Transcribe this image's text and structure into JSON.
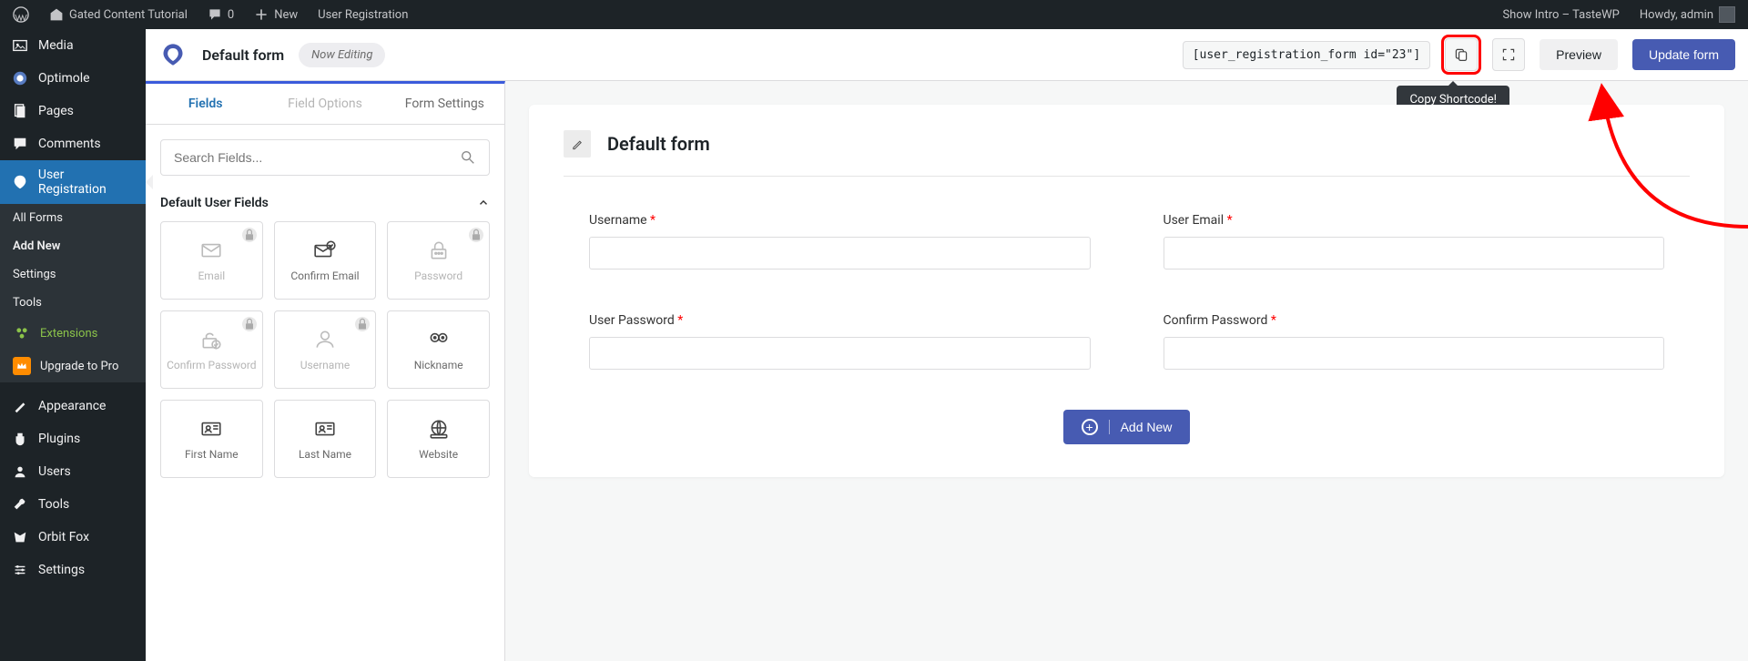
{
  "adminbar": {
    "site_title": "Gated Content Tutorial",
    "comments_count": "0",
    "new_label": "New",
    "context_link": "User Registration",
    "show_intro": "Show Intro – TasteWP",
    "greeting": "Howdy, admin"
  },
  "sidebar": {
    "items": [
      {
        "label": "Media",
        "icon": "media"
      },
      {
        "label": "Optimole",
        "icon": "optimole"
      },
      {
        "label": "Pages",
        "icon": "pages"
      },
      {
        "label": "Comments",
        "icon": "comments"
      },
      {
        "label": "User Registration",
        "icon": "ur",
        "active": true
      },
      {
        "label": "All Forms",
        "sub": true
      },
      {
        "label": "Add New",
        "sub": true,
        "bold": true
      },
      {
        "label": "Settings",
        "sub": true
      },
      {
        "label": "Tools",
        "sub": true
      },
      {
        "label": "Extensions",
        "sub": true,
        "ext": true,
        "icon": "ext"
      },
      {
        "label": "Upgrade to Pro",
        "sub": true,
        "crown": true,
        "icon": "crown"
      },
      {
        "label": "Appearance",
        "icon": "appearance"
      },
      {
        "label": "Plugins",
        "icon": "plugins"
      },
      {
        "label": "Users",
        "icon": "users"
      },
      {
        "label": "Tools",
        "icon": "tools"
      },
      {
        "label": "Orbit Fox",
        "icon": "orbit"
      },
      {
        "label": "Settings",
        "icon": "settings"
      }
    ]
  },
  "topbar": {
    "title": "Default form",
    "status_pill": "Now Editing",
    "shortcode": "[user_registration_form id=\"23\"]",
    "preview_label": "Preview",
    "update_label": "Update form",
    "tooltip": "Copy Shortcode!"
  },
  "left_panel": {
    "tabs": [
      {
        "label": "Fields",
        "state": "active"
      },
      {
        "label": "Field Options",
        "state": "disabled"
      },
      {
        "label": "Form Settings",
        "state": "normal"
      }
    ],
    "search_placeholder": "Search Fields...",
    "section_title": "Default User Fields",
    "cards": [
      {
        "label": "Email",
        "muted": true,
        "lock": true,
        "icon": "mail"
      },
      {
        "label": "Confirm Email",
        "muted": false,
        "lock": false,
        "icon": "mailcheck"
      },
      {
        "label": "Password",
        "muted": true,
        "lock": true,
        "icon": "lockdots"
      },
      {
        "label": "Confirm Password",
        "muted": true,
        "lock": true,
        "icon": "lockcheck"
      },
      {
        "label": "Username",
        "muted": true,
        "lock": true,
        "icon": "person"
      },
      {
        "label": "Nickname",
        "muted": false,
        "lock": false,
        "icon": "face"
      },
      {
        "label": "First Name",
        "muted": false,
        "lock": false,
        "icon": "idcard"
      },
      {
        "label": "Last Name",
        "muted": false,
        "lock": false,
        "icon": "idcard"
      },
      {
        "label": "Website",
        "muted": false,
        "lock": false,
        "icon": "globe"
      }
    ]
  },
  "canvas": {
    "form_title": "Default form",
    "fields": [
      {
        "label": "Username",
        "required": true
      },
      {
        "label": "User Email",
        "required": true
      },
      {
        "label": "User Password",
        "required": true
      },
      {
        "label": "Confirm Password",
        "required": true
      }
    ],
    "add_new_label": "Add New"
  }
}
